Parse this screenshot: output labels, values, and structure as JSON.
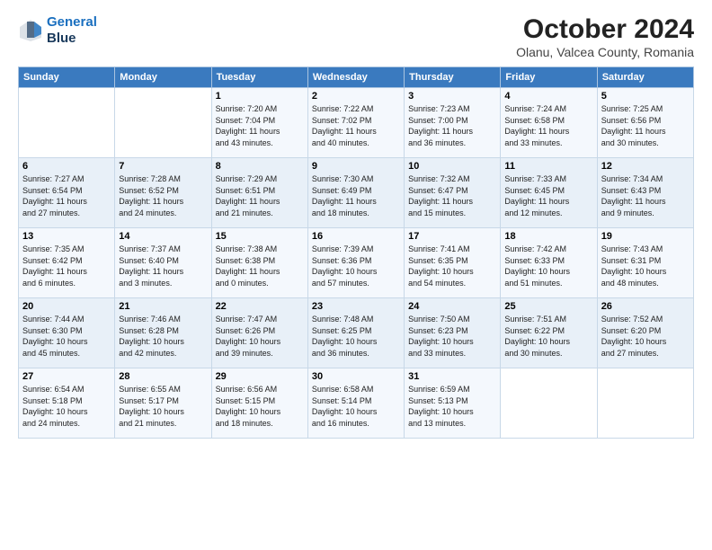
{
  "header": {
    "logo_line1": "General",
    "logo_line2": "Blue",
    "month": "October 2024",
    "location": "Olanu, Valcea County, Romania"
  },
  "weekdays": [
    "Sunday",
    "Monday",
    "Tuesday",
    "Wednesday",
    "Thursday",
    "Friday",
    "Saturday"
  ],
  "weeks": [
    [
      {
        "day": "",
        "info": ""
      },
      {
        "day": "",
        "info": ""
      },
      {
        "day": "1",
        "info": "Sunrise: 7:20 AM\nSunset: 7:04 PM\nDaylight: 11 hours\nand 43 minutes."
      },
      {
        "day": "2",
        "info": "Sunrise: 7:22 AM\nSunset: 7:02 PM\nDaylight: 11 hours\nand 40 minutes."
      },
      {
        "day": "3",
        "info": "Sunrise: 7:23 AM\nSunset: 7:00 PM\nDaylight: 11 hours\nand 36 minutes."
      },
      {
        "day": "4",
        "info": "Sunrise: 7:24 AM\nSunset: 6:58 PM\nDaylight: 11 hours\nand 33 minutes."
      },
      {
        "day": "5",
        "info": "Sunrise: 7:25 AM\nSunset: 6:56 PM\nDaylight: 11 hours\nand 30 minutes."
      }
    ],
    [
      {
        "day": "6",
        "info": "Sunrise: 7:27 AM\nSunset: 6:54 PM\nDaylight: 11 hours\nand 27 minutes."
      },
      {
        "day": "7",
        "info": "Sunrise: 7:28 AM\nSunset: 6:52 PM\nDaylight: 11 hours\nand 24 minutes."
      },
      {
        "day": "8",
        "info": "Sunrise: 7:29 AM\nSunset: 6:51 PM\nDaylight: 11 hours\nand 21 minutes."
      },
      {
        "day": "9",
        "info": "Sunrise: 7:30 AM\nSunset: 6:49 PM\nDaylight: 11 hours\nand 18 minutes."
      },
      {
        "day": "10",
        "info": "Sunrise: 7:32 AM\nSunset: 6:47 PM\nDaylight: 11 hours\nand 15 minutes."
      },
      {
        "day": "11",
        "info": "Sunrise: 7:33 AM\nSunset: 6:45 PM\nDaylight: 11 hours\nand 12 minutes."
      },
      {
        "day": "12",
        "info": "Sunrise: 7:34 AM\nSunset: 6:43 PM\nDaylight: 11 hours\nand 9 minutes."
      }
    ],
    [
      {
        "day": "13",
        "info": "Sunrise: 7:35 AM\nSunset: 6:42 PM\nDaylight: 11 hours\nand 6 minutes."
      },
      {
        "day": "14",
        "info": "Sunrise: 7:37 AM\nSunset: 6:40 PM\nDaylight: 11 hours\nand 3 minutes."
      },
      {
        "day": "15",
        "info": "Sunrise: 7:38 AM\nSunset: 6:38 PM\nDaylight: 11 hours\nand 0 minutes."
      },
      {
        "day": "16",
        "info": "Sunrise: 7:39 AM\nSunset: 6:36 PM\nDaylight: 10 hours\nand 57 minutes."
      },
      {
        "day": "17",
        "info": "Sunrise: 7:41 AM\nSunset: 6:35 PM\nDaylight: 10 hours\nand 54 minutes."
      },
      {
        "day": "18",
        "info": "Sunrise: 7:42 AM\nSunset: 6:33 PM\nDaylight: 10 hours\nand 51 minutes."
      },
      {
        "day": "19",
        "info": "Sunrise: 7:43 AM\nSunset: 6:31 PM\nDaylight: 10 hours\nand 48 minutes."
      }
    ],
    [
      {
        "day": "20",
        "info": "Sunrise: 7:44 AM\nSunset: 6:30 PM\nDaylight: 10 hours\nand 45 minutes."
      },
      {
        "day": "21",
        "info": "Sunrise: 7:46 AM\nSunset: 6:28 PM\nDaylight: 10 hours\nand 42 minutes."
      },
      {
        "day": "22",
        "info": "Sunrise: 7:47 AM\nSunset: 6:26 PM\nDaylight: 10 hours\nand 39 minutes."
      },
      {
        "day": "23",
        "info": "Sunrise: 7:48 AM\nSunset: 6:25 PM\nDaylight: 10 hours\nand 36 minutes."
      },
      {
        "day": "24",
        "info": "Sunrise: 7:50 AM\nSunset: 6:23 PM\nDaylight: 10 hours\nand 33 minutes."
      },
      {
        "day": "25",
        "info": "Sunrise: 7:51 AM\nSunset: 6:22 PM\nDaylight: 10 hours\nand 30 minutes."
      },
      {
        "day": "26",
        "info": "Sunrise: 7:52 AM\nSunset: 6:20 PM\nDaylight: 10 hours\nand 27 minutes."
      }
    ],
    [
      {
        "day": "27",
        "info": "Sunrise: 6:54 AM\nSunset: 5:18 PM\nDaylight: 10 hours\nand 24 minutes."
      },
      {
        "day": "28",
        "info": "Sunrise: 6:55 AM\nSunset: 5:17 PM\nDaylight: 10 hours\nand 21 minutes."
      },
      {
        "day": "29",
        "info": "Sunrise: 6:56 AM\nSunset: 5:15 PM\nDaylight: 10 hours\nand 18 minutes."
      },
      {
        "day": "30",
        "info": "Sunrise: 6:58 AM\nSunset: 5:14 PM\nDaylight: 10 hours\nand 16 minutes."
      },
      {
        "day": "31",
        "info": "Sunrise: 6:59 AM\nSunset: 5:13 PM\nDaylight: 10 hours\nand 13 minutes."
      },
      {
        "day": "",
        "info": ""
      },
      {
        "day": "",
        "info": ""
      }
    ]
  ]
}
